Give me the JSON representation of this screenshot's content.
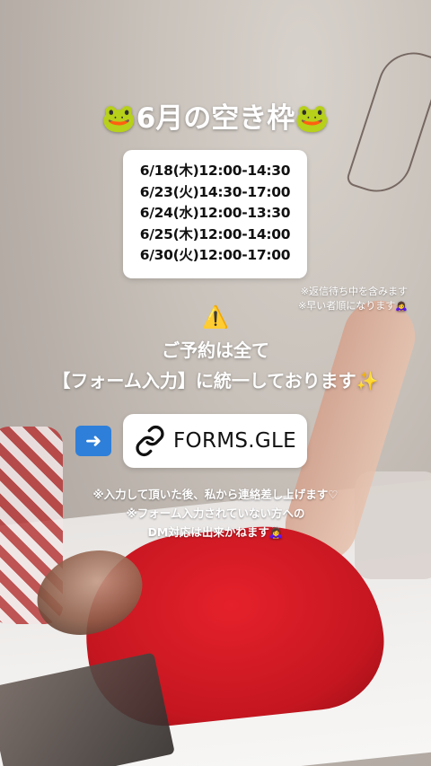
{
  "title": "🐸6月の空き枠🐸",
  "dates": [
    "6/18(木)12:00-14:30",
    "6/23(火)14:30-17:00",
    "6/24(水)12:00-13:30",
    "6/25(木)12:00-14:00",
    "6/30(火)12:00-17:00"
  ],
  "notes_top": [
    "※返信待ち中を含みます",
    "※早い者順になります🙇‍♀️"
  ],
  "warning_icon": "⚠️",
  "headline": [
    "ご予約は全て",
    "【フォーム入力】に統一しております✨"
  ],
  "arrow_icon": "➡️",
  "link": {
    "text": "FORMS.GLE",
    "icon": "link-icon"
  },
  "notes_bottom": [
    "※入力して頂いた後、私から連絡差し上げます♡",
    "※フォーム入力されていない方への",
    "DM対応は出来かねます🙇‍♀️"
  ]
}
